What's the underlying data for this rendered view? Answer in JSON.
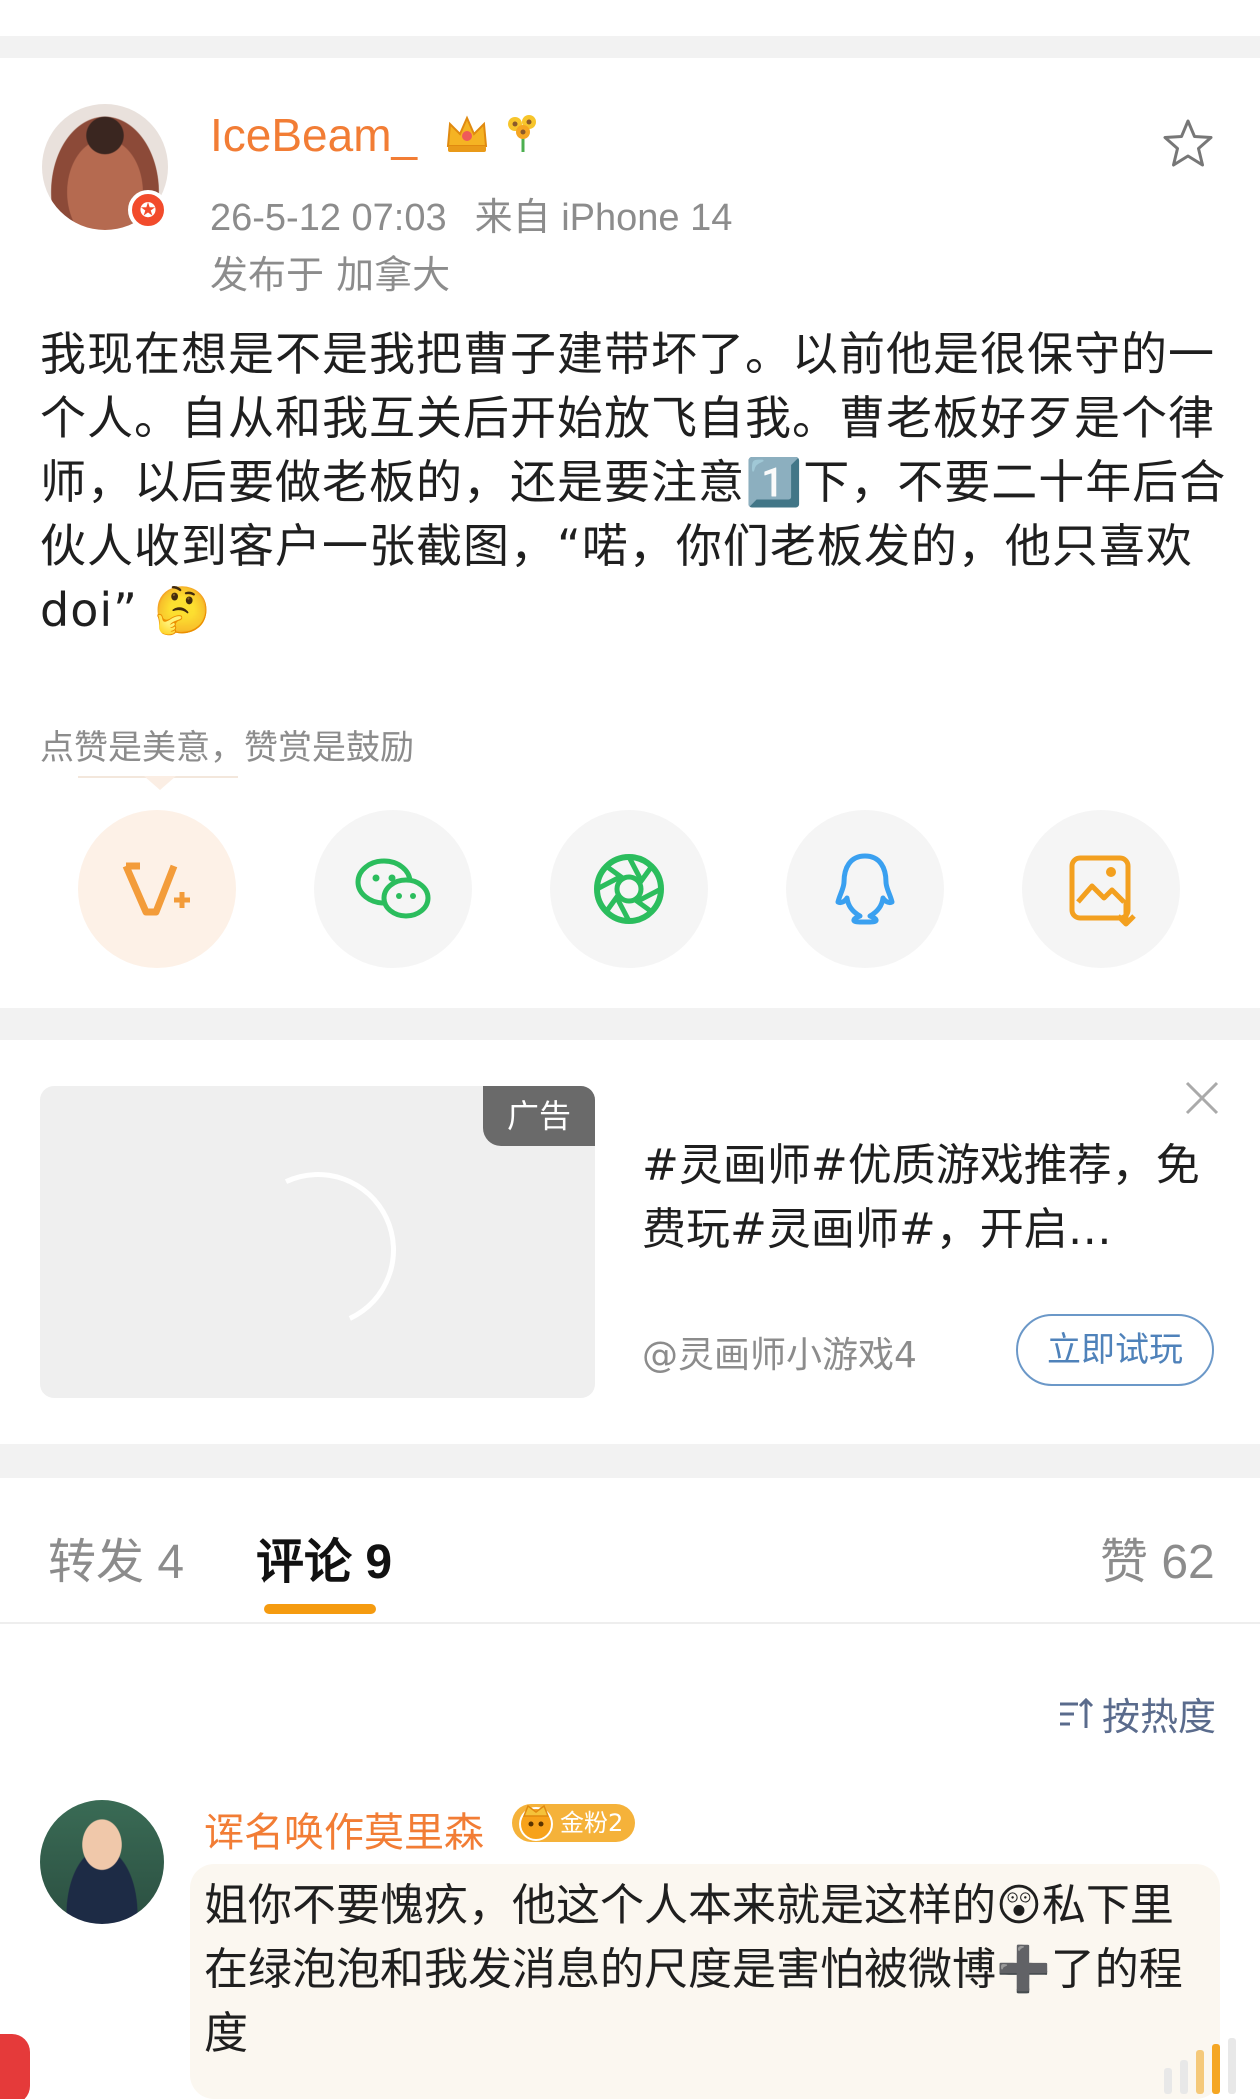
{
  "post": {
    "username": "IceBeam_",
    "time": "26-5-12 07:03",
    "source": "来自 iPhone 14",
    "location": "发布于 加拿大",
    "text": "我现在想是不是我把曹子建带坏了。以前他是很保守的一个人。自从和我互关后开始放飞自我。曹老板好歹是个律师，以后要做老板的，还是要注意1️⃣下，不要二十年后合伙人收到客户一张截图，“喏，你们老板发的，他只喜欢doi” 🤔",
    "reward_hint": "点赞是美意，赞赏是鼓励",
    "icons": [
      "avatar-verified-badge",
      "crown-icon",
      "flower-icon",
      "star-icon"
    ]
  },
  "share": {
    "buttons": [
      "reward-v-plus-icon",
      "wechat-icon",
      "moments-icon",
      "qq-icon",
      "save-image-icon"
    ],
    "colors": {
      "reward": "#f39c3a",
      "wechat": "#2bbd5d",
      "moments": "#2bbd5d",
      "qq": "#3aa0f0",
      "save": "#f3a01f"
    }
  },
  "ad": {
    "tag": "广告",
    "text": "#灵画师#优质游戏推荐，免费玩#灵画师#，开启…",
    "account": "@灵画师小游戏4",
    "cta": "立即试玩"
  },
  "tabs": {
    "repost": "转发 4",
    "comment": "评论 9",
    "like": "赞 62"
  },
  "sort": {
    "label": "按热度"
  },
  "comment": {
    "name": "诨名唤作莫里森",
    "badge": "金粉2",
    "text": "姐你不要愧疚，他这个人本来就是这样的😲私下里在绿泡泡和我发消息的尺度是害怕被微博➕了的程度"
  },
  "colors": {
    "accent": "#f27d35",
    "tab_indicator": "#f59b10",
    "link": "#4f82ba"
  }
}
